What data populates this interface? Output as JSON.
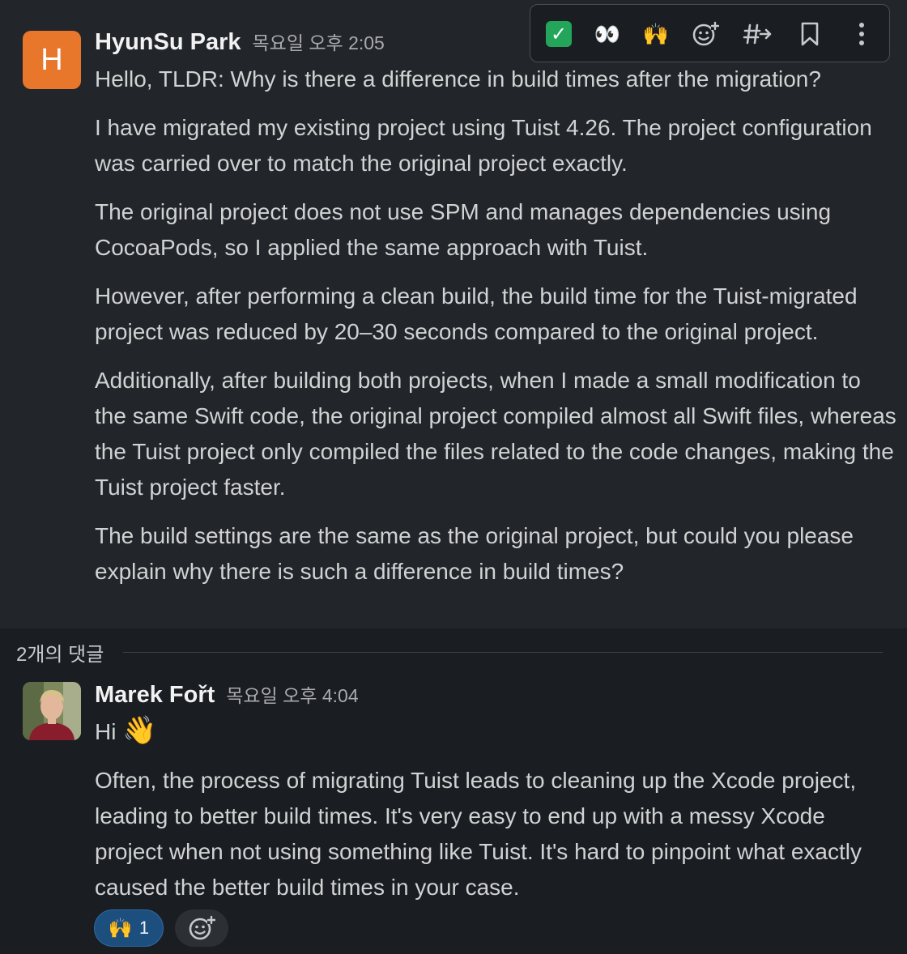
{
  "thread": {
    "root": {
      "avatar_initial": "H",
      "author": "HyunSu Park",
      "timestamp": "목요일 오후 2:05",
      "paragraphs": [
        "Hello,  TLDR: Why is there a difference in build times after the migration?",
        "I have migrated my existing project using Tuist 4.26. The project configuration was carried over to match the original project exactly.",
        "The original project does not use SPM and manages dependencies using CocoaPods, so I applied the same approach with Tuist.",
        "However, after performing a clean build, the build time for the Tuist-migrated project was reduced by 20–30 seconds compared to the original project.",
        "Additionally, after building both projects, when I made a small modification to the same Swift code, the original project compiled almost all Swift files, whereas the Tuist project only compiled the files related to the code changes, making the Tuist project faster.",
        "The build settings are the same as the original project, but could you please explain why there is such a difference in build times?"
      ]
    },
    "toolbar": {
      "check_emoji": "✓",
      "eyes_emoji": "👀",
      "raised_hands_emoji": "🙌",
      "add_reaction_icon": "add-emoji-icon",
      "forward_icon": "hash-forward-icon",
      "bookmark_icon": "bookmark-icon",
      "more_icon": "more-vertical-icon",
      "accent_green": "#23a55a"
    },
    "replies_label": "2개의 댓글",
    "reply": {
      "author": "Marek Fořt",
      "timestamp": "목요일 오후 4:04",
      "greeting": "Hi",
      "greeting_emoji": "👋",
      "paragraph": "Often, the process of migrating Tuist leads to cleaning up the Xcode project, leading to better build times. It's very easy to end up with a messy Xcode project when not using something like Tuist. It's hard to pinpoint what exactly caused the better build times in your case.",
      "reaction": {
        "emoji": "🙌",
        "count": "1"
      }
    }
  },
  "colors": {
    "background": "#1a1d21",
    "hover_background": "#222529",
    "avatar_orange": "#e8762b",
    "reaction_active": "#1d4f7e"
  }
}
